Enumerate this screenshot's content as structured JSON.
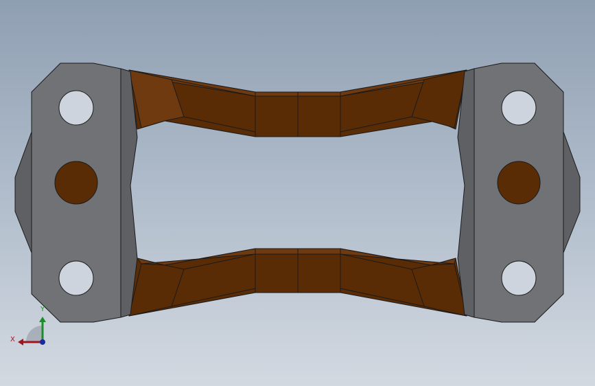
{
  "scene": {
    "background_top": "#8f9fb2",
    "background_bottom": "#d3d9e1",
    "plate_color": "#707276",
    "plate_side_color": "#5e6064",
    "web_color": "#5a2c06",
    "web_light_color": "#6f3a10",
    "edge_color": "#1a1a1a"
  },
  "triad": {
    "x_label": "X",
    "y_label": "Y",
    "x_color": "#a0141e",
    "y_color": "#1a8c2a",
    "z_color": "#1a2aa0"
  }
}
